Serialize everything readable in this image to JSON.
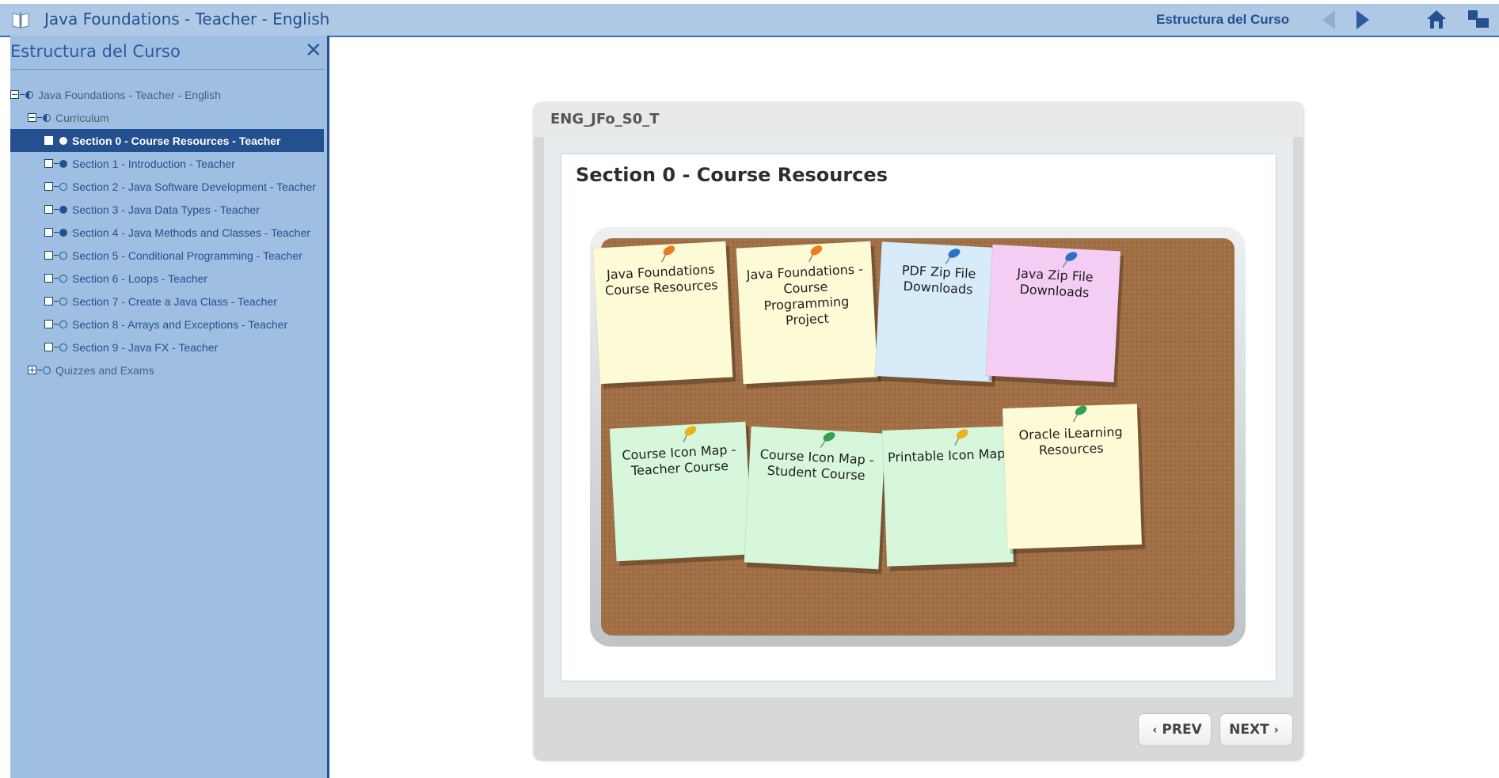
{
  "header": {
    "app_title": "Java Foundations - Teacher - English",
    "structure_link": "Estructura del Curso",
    "icons": [
      "book-icon",
      "arrow-left-icon",
      "arrow-right-icon",
      "home-icon",
      "window-icon"
    ]
  },
  "sidebar": {
    "title": "Estructura del Curso",
    "close_label": "✕",
    "tree": [
      {
        "label": "Java Foundations - Teacher - English",
        "level": 0,
        "expander": "minus",
        "status": "half",
        "selected": false,
        "muted": true
      },
      {
        "label": "Curriculum",
        "level": 1,
        "expander": "minus",
        "status": "half",
        "selected": false,
        "muted": true
      },
      {
        "label": "Section 0 - Course Resources - Teacher",
        "level": 2,
        "expander": "box",
        "status": "full",
        "selected": true,
        "muted": false
      },
      {
        "label": "Section 1 - Introduction - Teacher",
        "level": 2,
        "expander": "box",
        "status": "full",
        "selected": false,
        "muted": false
      },
      {
        "label": "Section 2 - Java Software Development - Teacher",
        "level": 2,
        "expander": "box",
        "status": "empty",
        "selected": false,
        "muted": false
      },
      {
        "label": "Section 3 - Java Data Types - Teacher",
        "level": 2,
        "expander": "box",
        "status": "full",
        "selected": false,
        "muted": false
      },
      {
        "label": "Section 4 - Java Methods and Classes - Teacher",
        "level": 2,
        "expander": "box",
        "status": "full",
        "selected": false,
        "muted": false
      },
      {
        "label": "Section 5 - Conditional Programming - Teacher",
        "level": 2,
        "expander": "box",
        "status": "empty",
        "selected": false,
        "muted": false
      },
      {
        "label": "Section 6 - Loops - Teacher",
        "level": 2,
        "expander": "box",
        "status": "empty",
        "selected": false,
        "muted": false
      },
      {
        "label": "Section 7 - Create a Java Class - Teacher",
        "level": 2,
        "expander": "box",
        "status": "empty",
        "selected": false,
        "muted": false
      },
      {
        "label": "Section 8 - Arrays and Exceptions - Teacher",
        "level": 2,
        "expander": "box",
        "status": "empty",
        "selected": false,
        "muted": false
      },
      {
        "label": "Section 9 - Java FX - Teacher",
        "level": 2,
        "expander": "box",
        "status": "empty",
        "selected": false,
        "muted": false
      },
      {
        "label": "Quizzes and Exams",
        "level": 1,
        "expander": "plus",
        "status": "empty",
        "selected": false,
        "muted": true
      }
    ]
  },
  "content": {
    "code": "ENG_JFo_S0_T",
    "slide_title": "Section 0 - Course Resources",
    "notes": [
      {
        "lines": [
          "Java Foundations",
          "Course Resources"
        ],
        "color": "#fdfbd6",
        "pin": "#f07a1e"
      },
      {
        "lines": [
          "Java Foundations -",
          "Course",
          "Programming",
          "Project"
        ],
        "color": "#fdfbd6",
        "pin": "#f07a1e"
      },
      {
        "lines": [
          "PDF Zip File",
          "Downloads"
        ],
        "color": "#d8ebf9",
        "pin": "#2a72c4"
      },
      {
        "lines": [
          "Java Zip File",
          "Downloads"
        ],
        "color": "#f3cdf3",
        "pin": "#2a72c4"
      },
      {
        "lines": [
          "Course Icon Map -",
          "Teacher Course"
        ],
        "color": "#d6f7dc",
        "pin": "#e8b21c"
      },
      {
        "lines": [
          "Course Icon Map -",
          "Student Course"
        ],
        "color": "#d6f7dc",
        "pin": "#35a050"
      },
      {
        "lines": [
          "Printable Icon Map"
        ],
        "color": "#d6f7dc",
        "pin": "#e8b21c"
      },
      {
        "lines": [
          "Oracle iLearning",
          "Resources"
        ],
        "color": "#fdfbd6",
        "pin": "#35a050"
      }
    ],
    "prev_label": "PREV",
    "next_label": "NEXT"
  },
  "colors": {
    "topbar": "#aec8e6",
    "sidebar": "#9fbfe2",
    "selected_row": "#24508f",
    "cork": "#9c6d45",
    "frame": "#cfd3d6"
  }
}
